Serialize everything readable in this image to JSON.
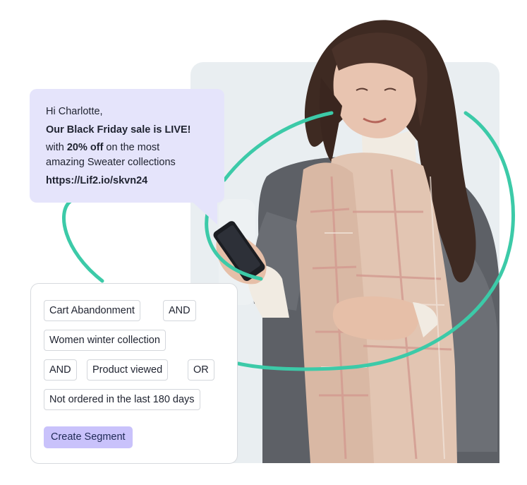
{
  "message": {
    "greeting": "Hi Charlotte,",
    "headline": "Our Black Friday sale is LIVE!",
    "offer_prefix": "with ",
    "offer_bold": "20% off",
    "offer_suffix": " on the most",
    "offer_line2": "amazing Sweater collections",
    "link": "https://Lif2.io/skvn24"
  },
  "segment_builder": {
    "conditions": [
      {
        "label": "Cart Abandonment"
      },
      {
        "label": "AND"
      },
      {
        "label": "Women winter collection"
      },
      {
        "label": "AND"
      },
      {
        "label": "Product viewed"
      },
      {
        "label": "OR"
      },
      {
        "label": "Not ordered in the last 180 days"
      }
    ],
    "create_button_label": "Create Segment"
  },
  "colors": {
    "accent_teal": "#3ccaa8",
    "bubble_bg": "#e5e4fb",
    "button_bg": "#c9c2fb"
  }
}
